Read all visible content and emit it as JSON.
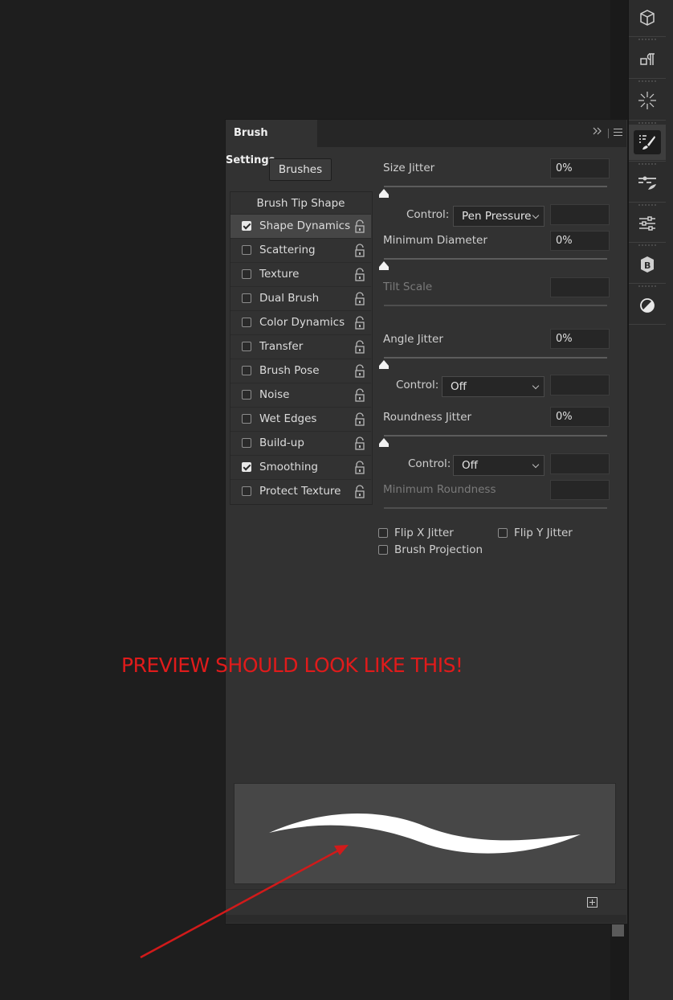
{
  "panel": {
    "title": "Brush Settings",
    "brushes_button": "Brushes",
    "brush_tip_shape": "Brush Tip Shape",
    "list_items": [
      {
        "label": "Shape Dynamics",
        "checked": true,
        "selected": true
      },
      {
        "label": "Scattering",
        "checked": false
      },
      {
        "label": "Texture",
        "checked": false
      },
      {
        "label": "Dual Brush",
        "checked": false
      },
      {
        "label": "Color Dynamics",
        "checked": false
      },
      {
        "label": "Transfer",
        "checked": false
      },
      {
        "label": "Brush Pose",
        "checked": false
      },
      {
        "label": "Noise",
        "checked": false
      },
      {
        "label": "Wet Edges",
        "checked": false
      },
      {
        "label": "Build-up",
        "checked": false
      },
      {
        "label": "Smoothing",
        "checked": true
      },
      {
        "label": "Protect Texture",
        "checked": false
      }
    ]
  },
  "settings": {
    "size_jitter": {
      "label": "Size Jitter",
      "value": "0%"
    },
    "size_control": {
      "label": "Control:",
      "value": "Pen Pressure"
    },
    "minimum_diameter": {
      "label": "Minimum Diameter",
      "value": "0%"
    },
    "tilt_scale": {
      "label": "Tilt Scale",
      "value": ""
    },
    "angle_jitter": {
      "label": "Angle Jitter",
      "value": "0%"
    },
    "angle_control": {
      "label": "Control:",
      "value": "Off"
    },
    "roundness_jitter": {
      "label": "Roundness Jitter",
      "value": "0%"
    },
    "roundness_control": {
      "label": "Control:",
      "value": "Off"
    },
    "minimum_roundness": {
      "label": "Minimum Roundness",
      "value": ""
    },
    "flip_x": {
      "label": "Flip X Jitter",
      "checked": false
    },
    "flip_y": {
      "label": "Flip Y Jitter",
      "checked": false
    },
    "brush_projection": {
      "label": "Brush Projection",
      "checked": false
    }
  },
  "annotation": {
    "text": "PREVIEW SHOULD LOOK LIKE THIS!",
    "color": "#e01b1b"
  },
  "dock": {
    "icons": [
      "3d-cube-icon",
      "paragraph-styles-icon",
      "starburst-icon",
      "brush-settings-icon",
      "brush-presets-icon",
      "adjustments-icon",
      "libraries-icon",
      "contrast-icon"
    ],
    "active": "brush-settings-icon"
  }
}
